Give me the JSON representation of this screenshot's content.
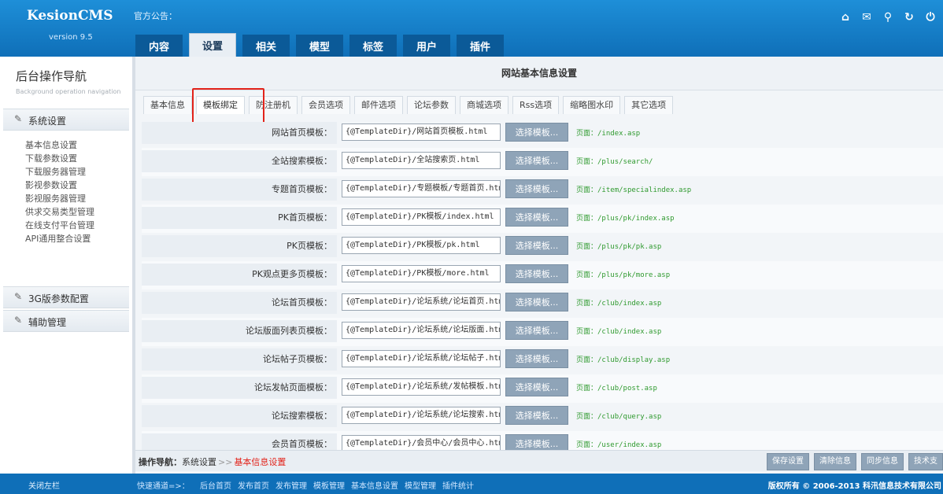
{
  "brand": {
    "name": "KesionCMS",
    "version": "version 9.5"
  },
  "header": {
    "notice": "官方公告：",
    "tabs": [
      {
        "label": "内容",
        "active": false
      },
      {
        "label": "设置",
        "active": true
      },
      {
        "label": "相关",
        "active": false
      },
      {
        "label": "模型",
        "active": false
      },
      {
        "label": "标签",
        "active": false
      },
      {
        "label": "用户",
        "active": false
      },
      {
        "label": "插件",
        "active": false
      }
    ],
    "icons": [
      "home-icon",
      "mail-icon",
      "search-icon",
      "refresh-icon",
      "power-icon"
    ]
  },
  "sidebar": {
    "title": "后台操作导航",
    "subtitle": "Background operation navigation",
    "groups": [
      {
        "label": "系统设置",
        "icon": "pencil-icon"
      },
      {
        "label": "3G版参数配置",
        "icon": "pencil-icon"
      },
      {
        "label": "辅助管理",
        "icon": "pencil-icon"
      }
    ],
    "items": [
      "基本信息设置",
      "下载参数设置",
      "下载服务器管理",
      "影视参数设置",
      "影视服务器管理",
      "供求交易类型管理",
      "在线支付平台管理",
      "API通用整合设置"
    ]
  },
  "main": {
    "title": "网站基本信息设置",
    "subtabs": [
      {
        "label": "基本信息",
        "active": false
      },
      {
        "label": "模板绑定",
        "active": true
      },
      {
        "label": "防注册机",
        "active": false
      },
      {
        "label": "会员选项",
        "active": false
      },
      {
        "label": "邮件选项",
        "active": false
      },
      {
        "label": "论坛参数",
        "active": false
      },
      {
        "label": "商城选项",
        "active": false
      },
      {
        "label": "Rss选项",
        "active": false
      },
      {
        "label": "缩略图水印",
        "active": false
      },
      {
        "label": "其它选项",
        "active": false
      }
    ],
    "button_label": "选择模板...",
    "path_prefix": "页面：",
    "rows": [
      {
        "label": "网站首页模板：",
        "value": "{@TemplateDir}/网站首页模板.html",
        "path": "/index.asp"
      },
      {
        "label": "全站搜索模板：",
        "value": "{@TemplateDir}/全站搜索页.html",
        "path": "/plus/search/"
      },
      {
        "label": "专题首页模板：",
        "value": "{@TemplateDir}/专题模板/专题首页.html",
        "path": "/item/specialindex.asp"
      },
      {
        "label": "PK首页模板：",
        "value": "{@TemplateDir}/PK模板/index.html",
        "path": "/plus/pk/index.asp"
      },
      {
        "label": "PK页模板：",
        "value": "{@TemplateDir}/PK模板/pk.html",
        "path": "/plus/pk/pk.asp"
      },
      {
        "label": "PK观点更多页模板：",
        "value": "{@TemplateDir}/PK模板/more.html",
        "path": "/plus/pk/more.asp"
      },
      {
        "label": "论坛首页模板：",
        "value": "{@TemplateDir}/论坛系统/论坛首页.html",
        "path": "/club/index.asp"
      },
      {
        "label": "论坛版面列表页模板：",
        "value": "{@TemplateDir}/论坛系统/论坛版面.html",
        "path": "/club/index.asp"
      },
      {
        "label": "论坛帖子页模板：",
        "value": "{@TemplateDir}/论坛系统/论坛帖子.html",
        "path": "/club/display.asp"
      },
      {
        "label": "论坛发帖页面模板：",
        "value": "{@TemplateDir}/论坛系统/发帖模板.html",
        "path": "/club/post.asp"
      },
      {
        "label": "论坛搜索模板：",
        "value": "{@TemplateDir}/论坛系统/论坛搜索.html",
        "path": "/club/query.asp"
      },
      {
        "label": "会员首页模板：",
        "value": "{@TemplateDir}/会员中心/会员中心.html",
        "path": "/user/index.asp"
      }
    ],
    "breadcrumb": {
      "label": "操作导航：",
      "parent": "系统设置",
      "sep": ">>",
      "current": "基本信息设置"
    },
    "actions": [
      "保存设置",
      "清除信息",
      "同步信息",
      "技术支"
    ]
  },
  "footer": {
    "left": "关闭左栏",
    "quick_label": "快速通道=>：",
    "quick_links": [
      "后台首页",
      "发布首页",
      "发布管理",
      "模板管理",
      "基本信息设置",
      "模型管理",
      "插件统计"
    ],
    "copyright": "版权所有 © 2006-2013 科汛信息技术有限公司"
  }
}
